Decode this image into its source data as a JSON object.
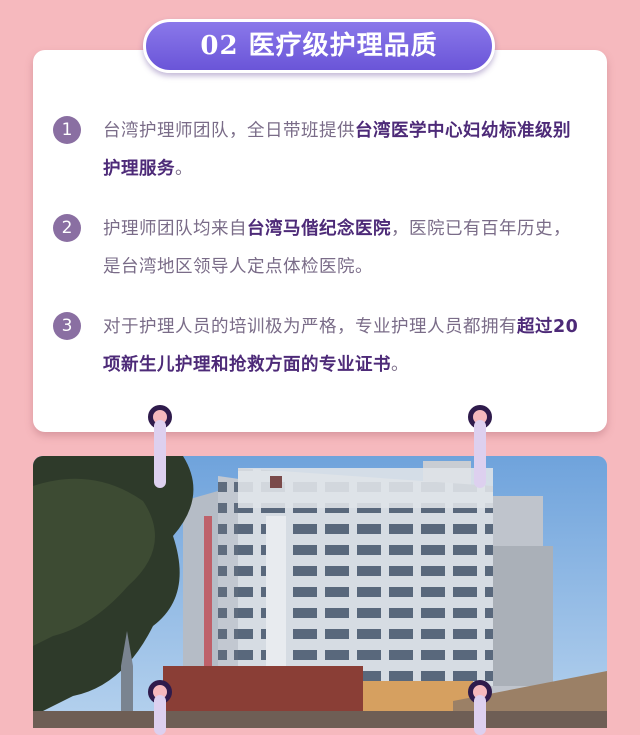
{
  "header": {
    "title": "02  医疗级护理品质"
  },
  "items": [
    {
      "num": "1",
      "parts": [
        {
          "t": "台湾护理师团队，全日带班提供",
          "b": false
        },
        {
          "t": "台湾医学中心妇幼标准级别护理服务",
          "b": true
        },
        {
          "t": "。",
          "b": false
        }
      ]
    },
    {
      "num": "2",
      "parts": [
        {
          "t": "护理师团队均来自",
          "b": false
        },
        {
          "t": "台湾马偕纪念医院",
          "b": true
        },
        {
          "t": "，医院已有百年历史，是台湾地区领导人定点体检医院。",
          "b": false
        }
      ]
    },
    {
      "num": "3",
      "parts": [
        {
          "t": "对于护理人员的培训极为严格，专业护理人员都拥有",
          "b": false
        },
        {
          "t": "超过20项新生儿护理和抢救方面的专业证书",
          "b": true
        },
        {
          "t": "。",
          "b": false
        }
      ]
    }
  ],
  "colors": {
    "background": "#f6b9be",
    "title_pill": "#7a66e0",
    "number_badge": "#8a6fa2",
    "body_text": "#7a6c88",
    "highlight_text": "#4d2a78"
  },
  "photo": {
    "icon": "hospital-building-photo"
  }
}
